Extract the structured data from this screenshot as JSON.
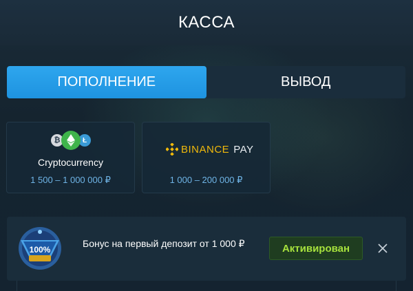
{
  "header": {
    "title": "КАССА"
  },
  "tabs": [
    {
      "label": "ПОПОЛНЕНИЕ",
      "active": true
    },
    {
      "label": "ВЫВОД",
      "active": false
    }
  ],
  "payment_methods": [
    {
      "name": "Cryptocurrency",
      "range": "1 500 – 1 000 000 ₽",
      "icon": "crypto-coins-icon"
    },
    {
      "logo_text": "BINANCE",
      "logo_suffix": "PAY",
      "range": "1 000 – 200 000 ₽",
      "icon": "binance-logo-icon"
    }
  ],
  "bonus": {
    "badge_text": "100%",
    "text": "Бонус на первый депозит от 1 000 ₽",
    "button_label": "Активирован",
    "close_icon": "close-icon"
  },
  "colors": {
    "accent": "#1e93e0",
    "range_text": "#6fb4e6",
    "binance": "#f0b90b",
    "activated": "#a7e23d"
  }
}
